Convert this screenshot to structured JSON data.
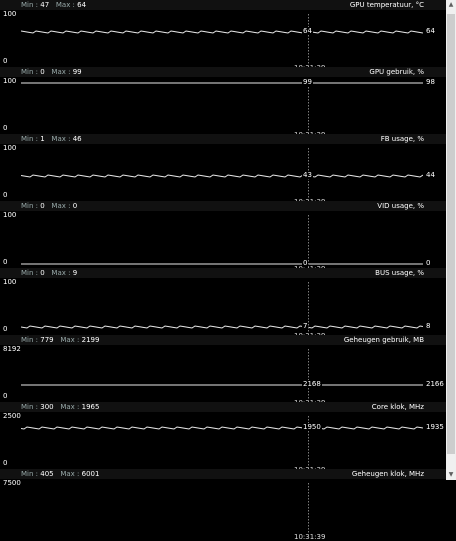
{
  "time": "10:31:39",
  "panels": [
    {
      "title": "GPU temperatuur, °C",
      "min": "47",
      "max": "64",
      "ymax": "100",
      "ymin": "0",
      "cursor": "64",
      "current": "64",
      "level": 0.64
    },
    {
      "title": "GPU gebruik, %",
      "min": "0",
      "max": "99",
      "ymax": "100",
      "ymin": "0",
      "cursor": "99",
      "current": "98",
      "level": 0.98
    },
    {
      "title": "FB usage, %",
      "min": "1",
      "max": "46",
      "ymax": "100",
      "ymin": "0",
      "cursor": "43",
      "current": "44",
      "level": 0.44
    },
    {
      "title": "VID usage, %",
      "min": "0",
      "max": "0",
      "ymax": "100",
      "ymin": "0",
      "cursor": "0",
      "current": "0",
      "level": 0.0
    },
    {
      "title": "BUS usage, %",
      "min": "0",
      "max": "9",
      "ymax": "100",
      "ymin": "0",
      "cursor": "7",
      "current": "8",
      "level": 0.08
    },
    {
      "title": "Geheugen gebruik, MB",
      "min": "779",
      "max": "2199",
      "ymax": "8192",
      "ymin": "0",
      "cursor": "2168",
      "current": "2166",
      "level": 0.264
    },
    {
      "title": "Core klok, MHz",
      "min": "300",
      "max": "1965",
      "ymax": "2500",
      "ymin": "0",
      "cursor": "1950",
      "current": "1935",
      "level": 0.774
    },
    {
      "title": "Geheugen klok, MHz",
      "min": "405",
      "max": "6001",
      "ymax": "7500",
      "ymin": "",
      "cursor": "",
      "current": "",
      "level": null
    }
  ],
  "labels": {
    "min": "Min :",
    "max": "Max :"
  },
  "icons": {
    "scroll_up": "triangle-up-icon",
    "scroll_down": "triangle-down-icon"
  }
}
